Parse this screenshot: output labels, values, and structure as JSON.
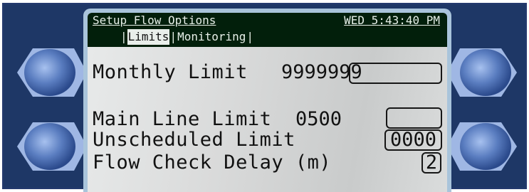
{
  "header": {
    "title": "Setup Flow Options",
    "clock": "WED 5:43:40 PM"
  },
  "tabs": [
    {
      "label": "Limits",
      "active": true
    },
    {
      "label": "Monitoring",
      "active": false
    }
  ],
  "tab_separator": "|",
  "fields": {
    "monthly_limit": {
      "label": "Monthly Limit",
      "value": "9999999"
    },
    "main_line_limit": {
      "label": "Main Line Limit",
      "value": "0500"
    },
    "unscheduled_limit": {
      "label": "Unscheduled Limit",
      "value": "0000"
    },
    "flow_check_delay": {
      "label": "Flow Check Delay (m)",
      "value": "2"
    }
  },
  "colors": {
    "bezel": "#1e3766",
    "title_bar": "#021f0b",
    "screen_background": "#d9dada",
    "softkey": "#5a7dc0"
  },
  "softkeys": [
    "softkey-left-top",
    "softkey-left-bottom",
    "softkey-right-top",
    "softkey-right-bottom"
  ]
}
